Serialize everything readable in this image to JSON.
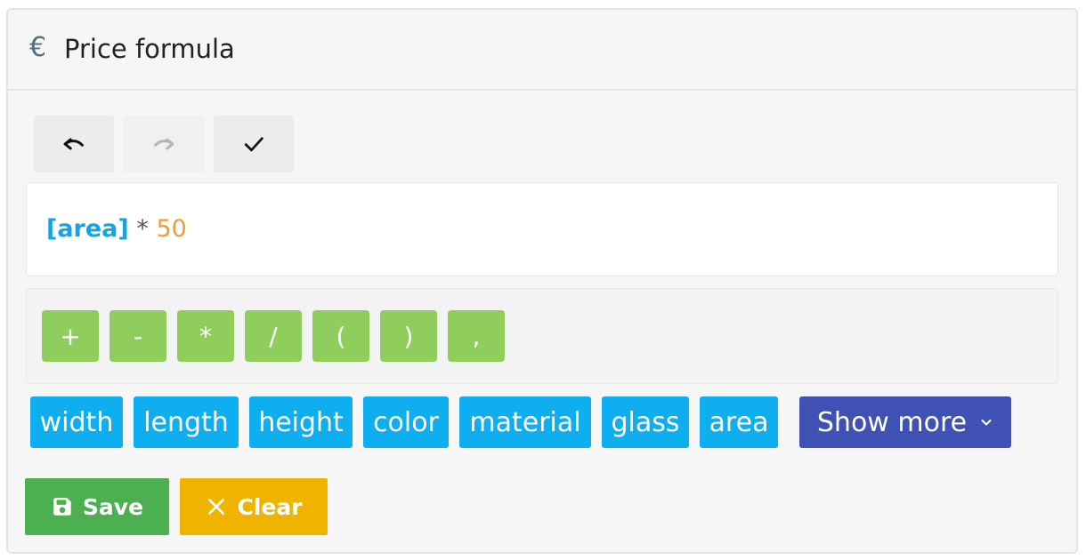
{
  "header": {
    "icon": "euro-icon",
    "currency_symbol": "€",
    "title": "Price formula"
  },
  "toolbar": {
    "undo": {
      "icon": "undo-icon",
      "enabled": true
    },
    "redo": {
      "icon": "redo-icon",
      "enabled": false
    },
    "validate": {
      "icon": "checkmark-icon",
      "enabled": true
    }
  },
  "formula": {
    "variable": "[area]",
    "operator": "*",
    "number": "50"
  },
  "operators": [
    "+",
    "-",
    "*",
    "/",
    "(",
    ")",
    ","
  ],
  "variables": [
    "width",
    "length",
    "height",
    "color",
    "material",
    "glass",
    "area"
  ],
  "show_more": {
    "label": "Show more",
    "icon": "chevron-down-icon"
  },
  "actions": {
    "save": {
      "label": "Save",
      "icon": "floppy-disk-icon"
    },
    "clear": {
      "label": "Clear",
      "icon": "close-icon"
    }
  },
  "colors": {
    "variable_button": "#0faef0",
    "operator_button": "#8fcd5c",
    "show_more_button": "#3f51b5",
    "save_button": "#4cb050",
    "clear_button": "#f0b400",
    "formula_variable": "#13a4e6",
    "formula_number": "#f29b3a"
  }
}
